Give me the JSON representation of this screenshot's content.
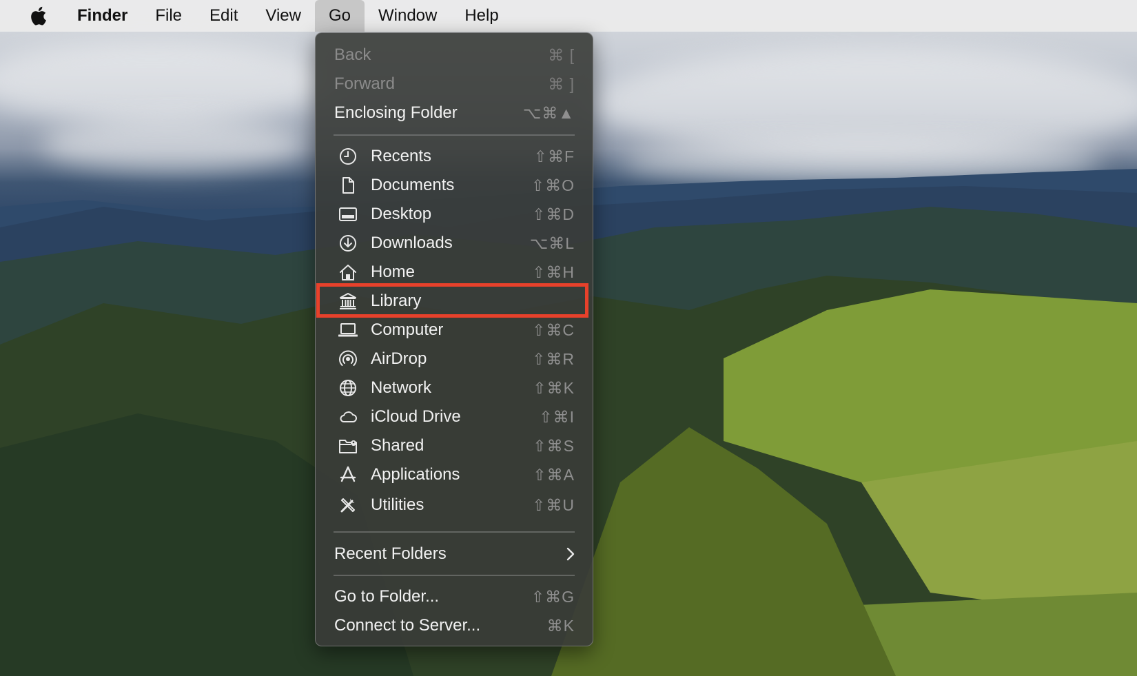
{
  "menubar": {
    "apple_icon": "apple-logo-icon",
    "items": [
      {
        "label": "Finder"
      },
      {
        "label": "File"
      },
      {
        "label": "Edit"
      },
      {
        "label": "View"
      },
      {
        "label": "Go"
      },
      {
        "label": "Window"
      },
      {
        "label": "Help"
      }
    ],
    "active_item": "Go"
  },
  "go_menu": {
    "items": [
      {
        "label": "Back",
        "shortcut": "⌘ [",
        "enabled": false
      },
      {
        "label": "Forward",
        "shortcut": "⌘ ]",
        "enabled": false
      },
      {
        "label": "Enclosing Folder",
        "shortcut": "⌥⌘▲",
        "enabled": true
      },
      {
        "label": "Recents",
        "shortcut": "⇧⌘F",
        "icon": "clock-icon"
      },
      {
        "label": "Documents",
        "shortcut": "⇧⌘O",
        "icon": "document-icon"
      },
      {
        "label": "Desktop",
        "shortcut": "⇧⌘D",
        "icon": "desktop-icon"
      },
      {
        "label": "Downloads",
        "shortcut": "⌥⌘L",
        "icon": "download-icon"
      },
      {
        "label": "Home",
        "shortcut": "⇧⌘H",
        "icon": "house-icon"
      },
      {
        "label": "Library",
        "shortcut": "",
        "icon": "library-icon",
        "highlighted": true
      },
      {
        "label": "Computer",
        "shortcut": "⇧⌘C",
        "icon": "laptop-icon"
      },
      {
        "label": "AirDrop",
        "shortcut": "⇧⌘R",
        "icon": "airdrop-icon"
      },
      {
        "label": "Network",
        "shortcut": "⇧⌘K",
        "icon": "globe-icon"
      },
      {
        "label": "iCloud Drive",
        "shortcut": "⇧⌘I",
        "icon": "cloud-icon"
      },
      {
        "label": "Shared",
        "shortcut": "⇧⌘S",
        "icon": "shared-folder-icon"
      },
      {
        "label": "Applications",
        "shortcut": "⇧⌘A",
        "icon": "applications-icon"
      },
      {
        "label": "Utilities",
        "shortcut": "⇧⌘U",
        "icon": "utilities-icon"
      },
      {
        "label": "Recent Folders",
        "shortcut": "",
        "submenu": true
      },
      {
        "label": "Go to Folder...",
        "shortcut": "⇧⌘G"
      },
      {
        "label": "Connect to Server...",
        "shortcut": "⌘K"
      }
    ]
  },
  "colors": {
    "highlight_border": "#e8412b",
    "menu_background": "#3a3c38",
    "menu_text": "#f2f2f2",
    "shortcut_text": "#8f8f8f"
  }
}
